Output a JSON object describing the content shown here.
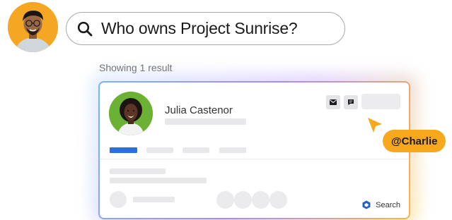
{
  "search": {
    "query": "Who owns Project Sunrise?",
    "icon": "search-icon"
  },
  "results": {
    "summary": "Showing 1 result"
  },
  "result_card": {
    "name": "Julia Castenor",
    "actions": [
      "mail-icon",
      "chat-icon"
    ],
    "product_label": "Search",
    "product_icon": "product-logo-icon"
  },
  "collaborator": {
    "label": "@Charlie"
  },
  "colors": {
    "accent_orange": "#f8a81d",
    "tab_blue": "#2a6fdb",
    "avatar_green": "#6bb234",
    "skeleton_gray": "#e8e8ea"
  }
}
